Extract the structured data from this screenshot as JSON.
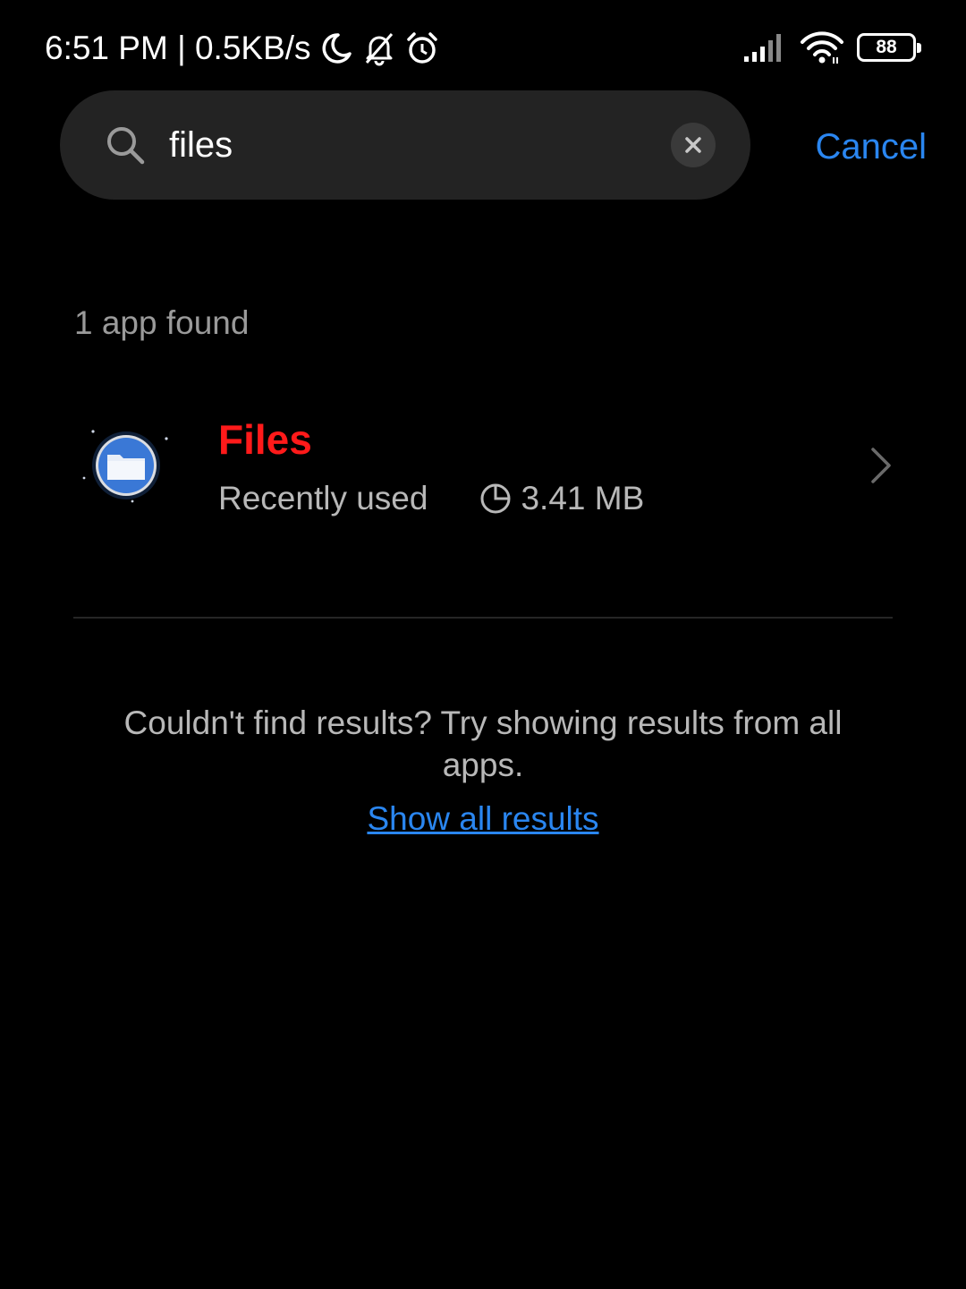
{
  "status_bar": {
    "time_speed": "6:51 PM | 0.5KB/s",
    "battery_level": "88",
    "icons": [
      "moon-icon",
      "bell-off-icon",
      "alarm-icon",
      "signal-icon",
      "wifi-icon",
      "battery-icon"
    ]
  },
  "search": {
    "value": "files",
    "cancel_label": "Cancel"
  },
  "results": {
    "count_label": "1 app found",
    "items": [
      {
        "name": "Files",
        "status": "Recently used",
        "size": "3.41 MB",
        "icon": "files-app-icon"
      }
    ]
  },
  "footer": {
    "hint": "Couldn't find results? Try showing results from all apps.",
    "link_label": "Show all results"
  },
  "colors": {
    "background": "#000000",
    "search_bg": "#232323",
    "accent_blue": "#2a86f0",
    "highlight_red": "#ff1a1a",
    "secondary_text": "#b8b8b8"
  }
}
